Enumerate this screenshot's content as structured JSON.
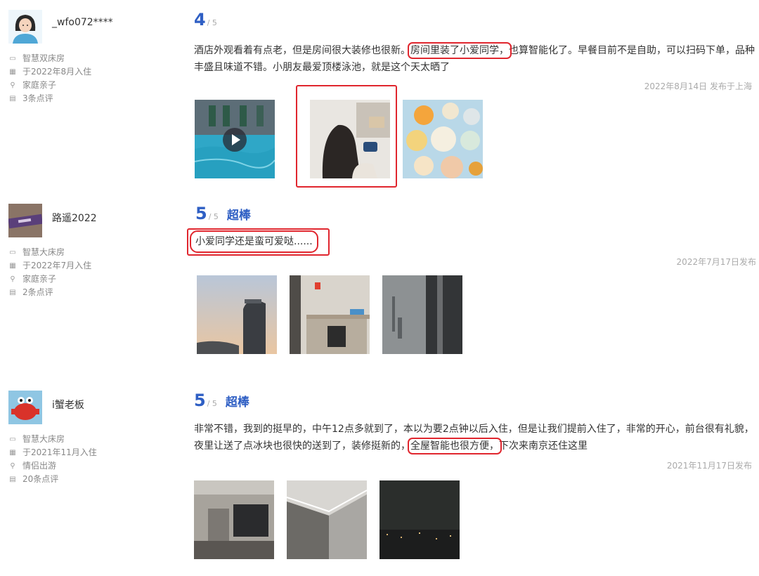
{
  "reviews": [
    {
      "user": {
        "name": "_wfo072****",
        "avatar_icon": "cartoon-girl-avatar",
        "room": "智慧双床房",
        "checkin": "于2022年8月入住",
        "trip_type": "家庭亲子",
        "review_count": "3条点评"
      },
      "score": "4",
      "score_max": "/ 5",
      "tag": "",
      "text_parts": [
        "酒店外观看着有点老，但是房间很大装修也很新。",
        "房间里装了小爱同学，",
        "也算智能化了。早餐目前不是自助，可以扫码下单，品种丰盛且味道不错。小朋友最爱顶楼泳池，就是这个天太晒了"
      ],
      "date": "2022年8月14日 发布于上海",
      "photos": [
        "pool-video",
        "girl-at-smart-speaker",
        "breakfast-dishes"
      ]
    },
    {
      "user": {
        "name": "路遥2022",
        "avatar_icon": "wristband-photo-avatar",
        "room": "智慧大床房",
        "checkin": "于2022年7月入住",
        "trip_type": "家庭亲子",
        "review_count": "2条点评"
      },
      "score": "5",
      "score_max": "/ 5",
      "tag": "超棒",
      "text_parts": [
        "小爱同学还是蛮可爱哒......"
      ],
      "date": "2022年7月17日发布",
      "photos": [
        "hotel-tower-sunset",
        "room-desk-minibar",
        "window-city-view"
      ]
    },
    {
      "user": {
        "name": "i蟹老板",
        "avatar_icon": "crab-cartoon-avatar",
        "room": "智慧大床房",
        "checkin": "于2021年11月入住",
        "trip_type": "情侣出游",
        "review_count": "20条点评"
      },
      "score": "5",
      "score_max": "/ 5",
      "tag": "超棒",
      "text_parts": [
        "非常不错，我到的挺早的，中午12点多就到了，本以为要2点钟以后入住，但是让我们提前入住了，非常的开心，前台很有礼貌，夜里让送了点冰块也很快的送到了，装修挺新的，",
        "全屋智能也很方便，",
        "下次来南京还住这里"
      ],
      "date": "2021年11月17日发布",
      "photos": [
        "room-tv-wall",
        "ceiling-light-corner",
        "night-skyline"
      ]
    }
  ],
  "colors": {
    "accent": "#2f5fc4",
    "highlight": "#e0262e",
    "meta": "#888888"
  }
}
